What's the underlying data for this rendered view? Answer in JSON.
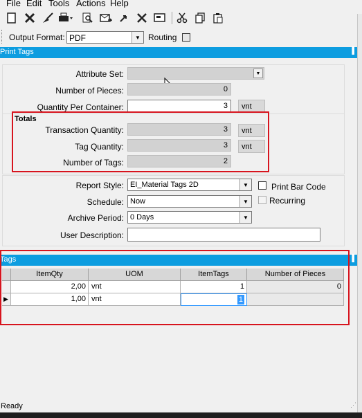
{
  "menu": [
    "File",
    "Edit",
    "Tools",
    "Actions",
    "Help"
  ],
  "toolbar": {
    "icons": [
      "new-icon",
      "delete-icon",
      "clear-icon",
      "print-icon",
      "print-preview-icon",
      "send-icon",
      "attachment-icon",
      "tools-icon",
      "screen-icon",
      "cut-icon",
      "copy-icon",
      "paste-icon"
    ]
  },
  "output": {
    "format_label": "Output Format:",
    "format_value": "PDF",
    "routing_label": "Routing"
  },
  "print_tags_panel": {
    "title": "Print Tags",
    "pin": "⭌"
  },
  "form": {
    "attribute_set_label": "Attribute Set:",
    "attribute_set_value": "",
    "number_of_pieces_label": "Number of Pieces:",
    "number_of_pieces_value": "0",
    "qty_per_container_label": "Quantity Per Container:",
    "qty_per_container_value": "3",
    "qty_per_container_unit": "vnt",
    "totals_title": "Totals",
    "transaction_qty_label": "Transaction Quantity:",
    "transaction_qty_value": "3",
    "transaction_qty_unit": "vnt",
    "tag_qty_label": "Tag Quantity:",
    "tag_qty_value": "3",
    "tag_qty_unit": "vnt",
    "number_of_tags_label": "Number of Tags:",
    "number_of_tags_value": "2",
    "report_style_label": "Report Style:",
    "report_style_value": "EI_Material Tags 2D",
    "print_bar_code_label": "Print Bar Code",
    "schedule_label": "Schedule:",
    "schedule_value": "Now",
    "recurring_label": "Recurring",
    "archive_period_label": "Archive Period:",
    "archive_period_value": "0 Days",
    "user_description_label": "User Description:",
    "user_description_value": ""
  },
  "tags_panel": {
    "title": "Tags",
    "columns": [
      "ItemQty",
      "UOM",
      "ItemTags",
      "Number of Pieces"
    ],
    "rows": [
      {
        "item_qty": "2,00",
        "uom": "vnt",
        "item_tags": "1",
        "pieces": "0"
      },
      {
        "item_qty": "1,00",
        "uom": "vnt",
        "item_tags": "1",
        "pieces": ""
      }
    ]
  },
  "status": "Ready",
  "colors": {
    "header_blue": "#0d9de0",
    "highlight_red": "#d7141e",
    "selection_blue": "#3399ff"
  }
}
